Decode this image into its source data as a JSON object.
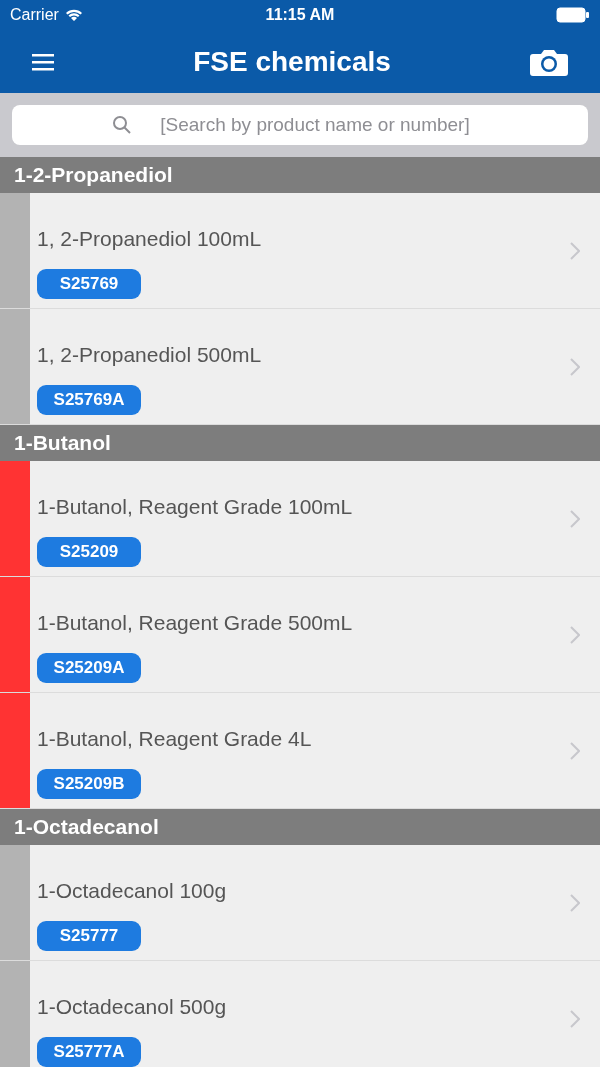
{
  "status_bar": {
    "carrier": "Carrier",
    "time": "11:15 AM"
  },
  "header": {
    "title": "FSE chemicals"
  },
  "search": {
    "placeholder": "[Search by product name or number]"
  },
  "sections": [
    {
      "title": "1-2-Propanediol",
      "items": [
        {
          "name": "1, 2-Propanediol 100mL",
          "code": "S25769",
          "color": "#b3b3b3"
        },
        {
          "name": "1, 2-Propanediol 500mL",
          "code": "S25769A",
          "color": "#b3b3b3"
        }
      ]
    },
    {
      "title": "1-Butanol",
      "items": [
        {
          "name": "1-Butanol, Reagent Grade 100mL",
          "code": "S25209",
          "color": "#ff3333"
        },
        {
          "name": "1-Butanol, Reagent Grade 500mL",
          "code": "S25209A",
          "color": "#ff3333"
        },
        {
          "name": "1-Butanol, Reagent Grade 4L",
          "code": "S25209B",
          "color": "#ff3333"
        }
      ]
    },
    {
      "title": "1-Octadecanol",
      "items": [
        {
          "name": "1-Octadecanol 100g",
          "code": "S25777",
          "color": "#b3b3b3"
        },
        {
          "name": "1-Octadecanol 500g",
          "code": "S25777A",
          "color": "#b3b3b3"
        }
      ]
    }
  ]
}
